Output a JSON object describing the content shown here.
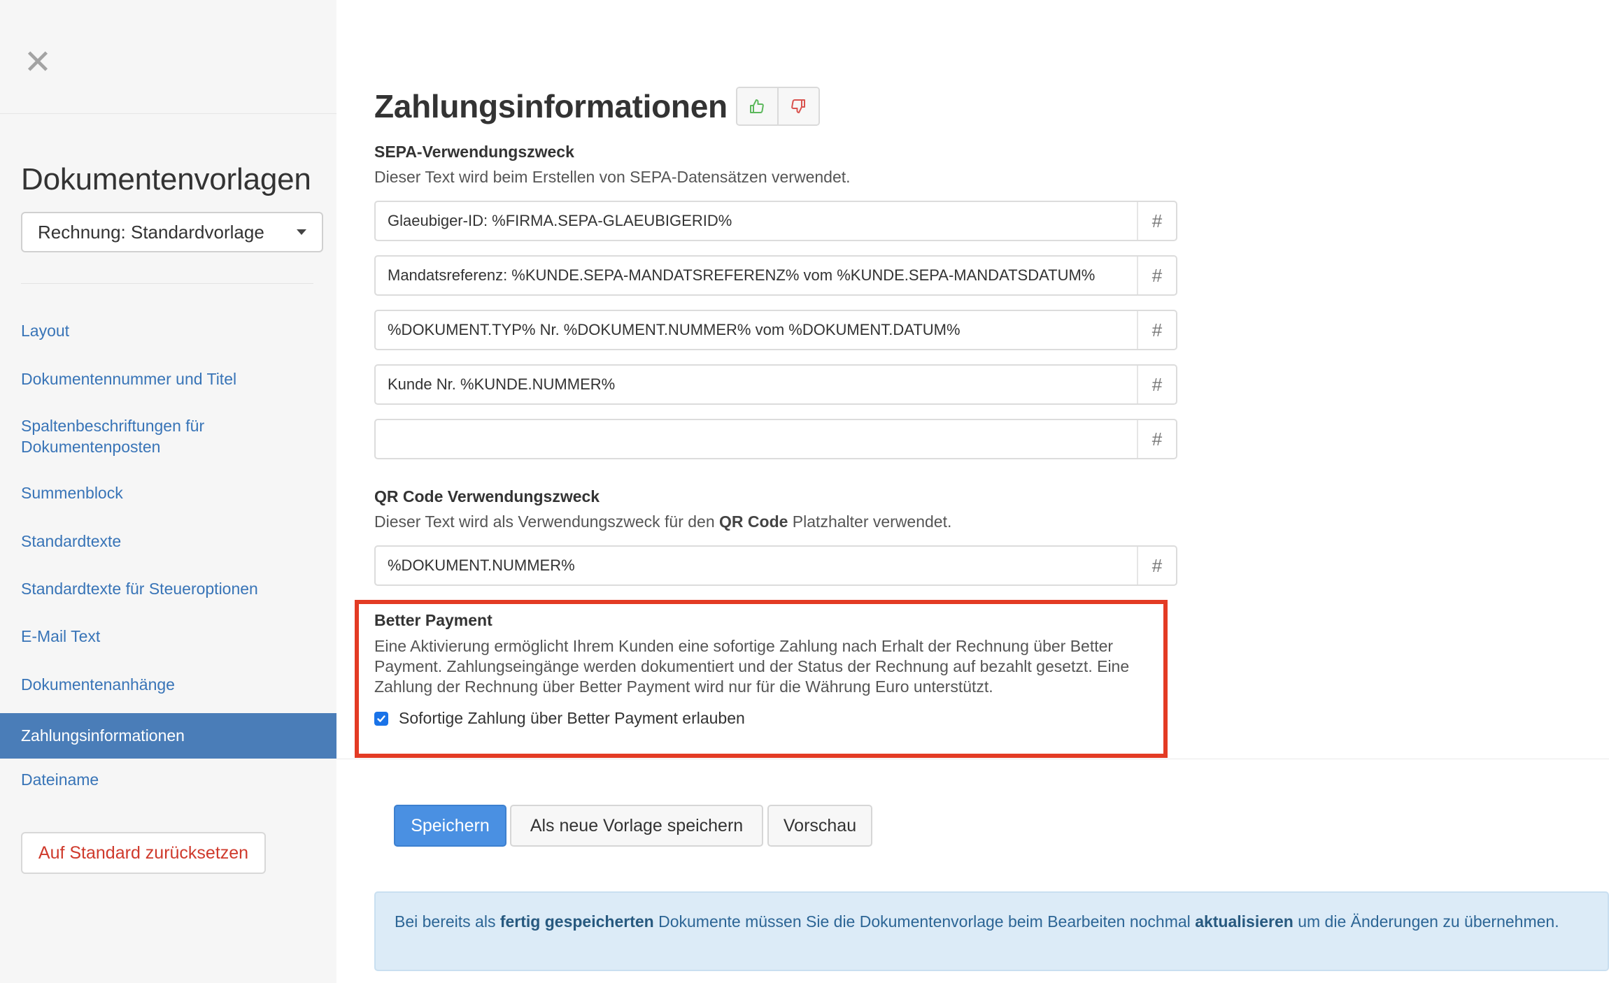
{
  "sidebar": {
    "close_label": "✕",
    "title": "Dokumentenvorlagen",
    "template_select": {
      "value": "Rechnung: Standardvorlage"
    },
    "items": [
      {
        "label": "Layout"
      },
      {
        "label": "Dokumentennummer und Titel"
      },
      {
        "label": "Spaltenbeschriftungen für Dokumentenposten"
      },
      {
        "label": "Summenblock"
      },
      {
        "label": "Standardtexte"
      },
      {
        "label": "Standardtexte für Steueroptionen"
      },
      {
        "label": "E-Mail Text"
      },
      {
        "label": "Dokumentenanhänge"
      },
      {
        "label": "Zahlungsinformationen",
        "active": true
      },
      {
        "label": "Dateiname"
      }
    ],
    "reset_label": "Auf Standard zurücksetzen"
  },
  "main": {
    "title": "Zahlungsinformationen",
    "sepa": {
      "label": "SEPA-Verwendungszweck",
      "description": "Dieser Text wird beim Erstellen von SEPA-Datensätzen verwendet.",
      "fields": [
        "Glaeubiger-ID: %FIRMA.SEPA-GLAEUBIGERID%",
        "Mandatsreferenz: %KUNDE.SEPA-MANDATSREFERENZ% vom %KUNDE.SEPA-MANDATSDATUM%",
        "%DOKUMENT.TYP% Nr. %DOKUMENT.NUMMER% vom %DOKUMENT.DATUM%",
        "Kunde Nr. %KUNDE.NUMMER%",
        ""
      ]
    },
    "qr": {
      "label": "QR Code Verwendungszweck",
      "description_pre": "Dieser Text wird als Verwendungszweck für den ",
      "description_bold": "QR Code",
      "description_post": " Platzhalter verwendet.",
      "field": "%DOKUMENT.NUMMER%"
    },
    "hash_symbol": "#",
    "better_payment": {
      "label": "Better Payment",
      "description": "Eine Aktivierung ermöglicht Ihrem Kunden eine sofortige Zahlung nach Erhalt der Rechnung über Better Payment. Zahlungseingänge werden dokumentiert und der Status der Rechnung auf bezahlt gesetzt. Eine Zahlung der Rechnung über Better Payment wird nur für die Währung Euro unterstützt.",
      "checkbox_label": "Sofortige Zahlung über Better Payment erlauben",
      "checked": true,
      "highlight_color": "#e33b24"
    },
    "buttons": {
      "save": "Speichern",
      "save_new": "Als neue Vorlage speichern",
      "preview": "Vorschau"
    },
    "info": {
      "t1": "Bei bereits als ",
      "b1": "fertig gespeicherten",
      "t2": " Dokumente müssen Sie die Dokumentenvorlage beim Bearbeiten nochmal ",
      "b2": "aktualisieren",
      "t3": " um die Änderungen zu übernehmen."
    }
  },
  "colors": {
    "accent": "#4a90e2",
    "link": "#3874b7",
    "nav_active": "#4a7db8",
    "danger": "#cf3a2c",
    "thumb_up": "#5cb85c",
    "thumb_down": "#d9534f"
  }
}
